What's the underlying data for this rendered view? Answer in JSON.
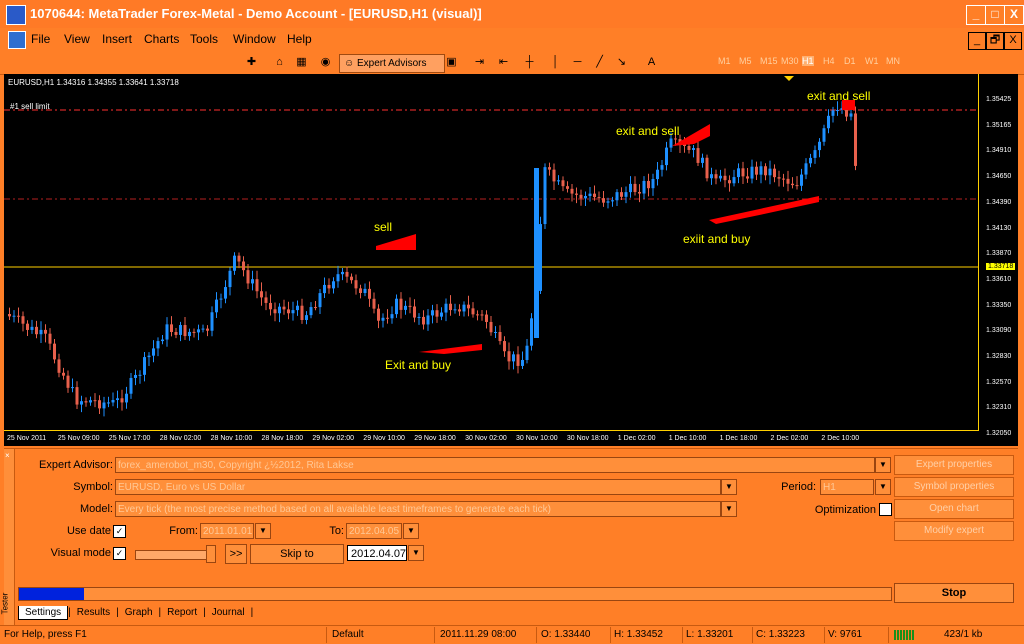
{
  "window": {
    "title": "1070644: MetaTrader Forex-Metal - Demo Account - [EURUSD,H1 (visual)]",
    "buttons": [
      "_",
      "□",
      "X"
    ]
  },
  "menu": {
    "items": [
      "File",
      "View",
      "Insert",
      "Charts",
      "Tools",
      "Window",
      "Help"
    ],
    "mdi_buttons": [
      "_",
      "🗗",
      "X"
    ]
  },
  "toolbar": {
    "expert_advisors": "Expert Advisors",
    "timeframes": [
      "M1",
      "M5",
      "M15",
      "M30",
      "H1",
      "H4",
      "D1",
      "W1",
      "MN"
    ],
    "active_timeframe": "H1"
  },
  "chart": {
    "header": "EURUSD,H1  1.34316 1.34355 1.33641 1.33718",
    "sell_limit_label": "#1 sell limit",
    "current_price": "1.33718",
    "price_ticks": [
      "1.35425",
      "1.35165",
      "1.34910",
      "1.34650",
      "1.34390",
      "1.34130",
      "1.33870",
      "1.33610",
      "1.33350",
      "1.33090",
      "1.32830",
      "1.32570",
      "1.32310",
      "1.32050"
    ],
    "time_ticks": [
      "25 Nov 2011",
      "25 Nov 09:00",
      "25 Nov 17:00",
      "28 Nov 02:00",
      "28 Nov 10:00",
      "28 Nov 18:00",
      "29 Nov 02:00",
      "29 Nov 10:00",
      "29 Nov 18:00",
      "30 Nov 02:00",
      "30 Nov 10:00",
      "30 Nov 18:00",
      "1 Dec 02:00",
      "1 Dec 10:00",
      "1 Dec 18:00",
      "2 Dec 02:00",
      "2 Dec 10:00"
    ],
    "annotations": {
      "sell": "sell",
      "exit_and_buy": "Exit and buy",
      "exit_and_sell_1": "exit and sell",
      "exit_and_sell_2": "exit and sell",
      "exiit_and_buy": "exiit and buy"
    },
    "colors": {
      "bull": "#1e90ff",
      "bear": "#e8604c",
      "hline": "#ffd000",
      "levels": "#ff3030",
      "arrows": "#ff0000"
    }
  },
  "tester": {
    "expert_advisor_label": "Expert Advisor:",
    "expert_advisor_value": "forex_amerobot_m30, Copyright ¿½2012, Rita Lakse",
    "symbol_label": "Symbol:",
    "symbol_value": "EURUSD, Euro vs US Dollar",
    "model_label": "Model:",
    "model_value": "Every tick (the most precise method based on all available least timeframes to generate each tick)",
    "period_label": "Period:",
    "period_value": "H1",
    "optimization_label": "Optimization",
    "use_date_label": "Use date",
    "from_label": "From:",
    "from_value": "2011.01.01",
    "to_label": "To:",
    "to_value": "2012.04.05",
    "visual_mode_label": "Visual mode",
    "skip_to_label": "Skip to",
    "skip_to_date": "2012.04.07",
    "fast_forward": ">>",
    "buttons": {
      "expert_properties": "Expert properties",
      "symbol_properties": "Symbol properties",
      "open_chart": "Open chart",
      "modify_expert": "Modify expert",
      "stop": "Stop"
    },
    "progress_fraction": 0.075,
    "tabs": [
      "Settings",
      "Results",
      "Graph",
      "Report",
      "Journal"
    ],
    "side_label": "Tester"
  },
  "status": {
    "help": "For Help, press F1",
    "profile": "Default",
    "datetime": "2011.11.29 08:00",
    "open": "O: 1.33440",
    "high": "H: 1.33452",
    "low": "L: 1.33201",
    "close": "C: 1.33223",
    "volume": "V: 9761",
    "traffic": "423/1 kb"
  }
}
